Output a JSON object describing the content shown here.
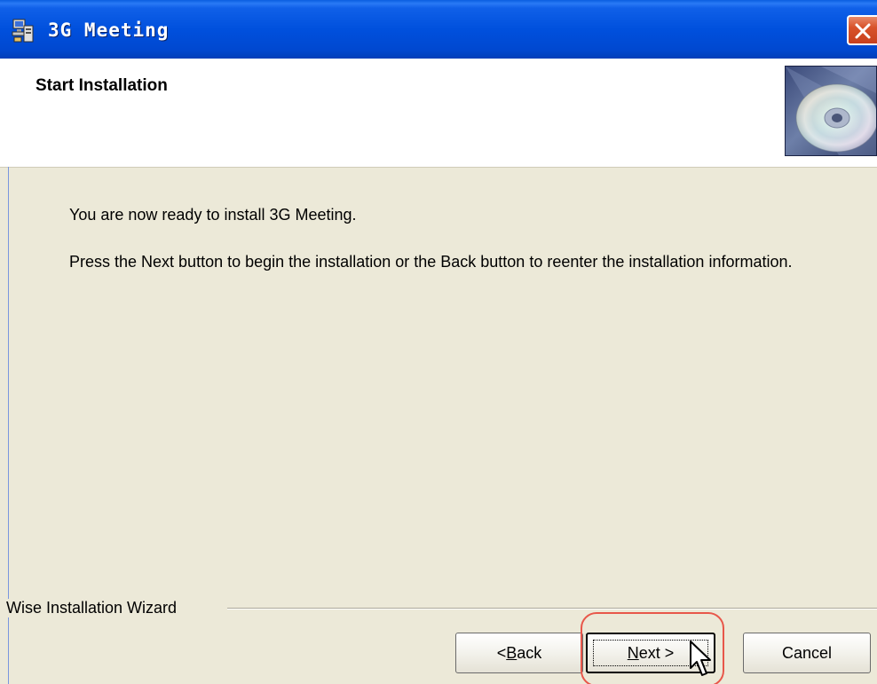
{
  "window": {
    "title": "3G Meeting"
  },
  "header": {
    "title": "Start Installation"
  },
  "body": {
    "line1": "You are now ready to install 3G Meeting.",
    "line2": "Press the Next button to begin the installation or the Back button to reenter the installation information."
  },
  "footer": {
    "wizard_label": "Wise Installation Wizard"
  },
  "buttons": {
    "back": {
      "prefix": "< ",
      "accel": "B",
      "rest": "ack"
    },
    "next": {
      "accel": "N",
      "rest": "ext >"
    },
    "cancel": "Cancel"
  },
  "colors": {
    "titlebar": "#0050dd",
    "dialog_bg": "#ece9d8",
    "close": "#d8532a",
    "highlight": "#e8574a"
  },
  "icons": {
    "app": "installer-computer-icon",
    "close": "close-icon",
    "header": "cd-disc-icon",
    "cursor": "mouse-pointer-icon"
  }
}
